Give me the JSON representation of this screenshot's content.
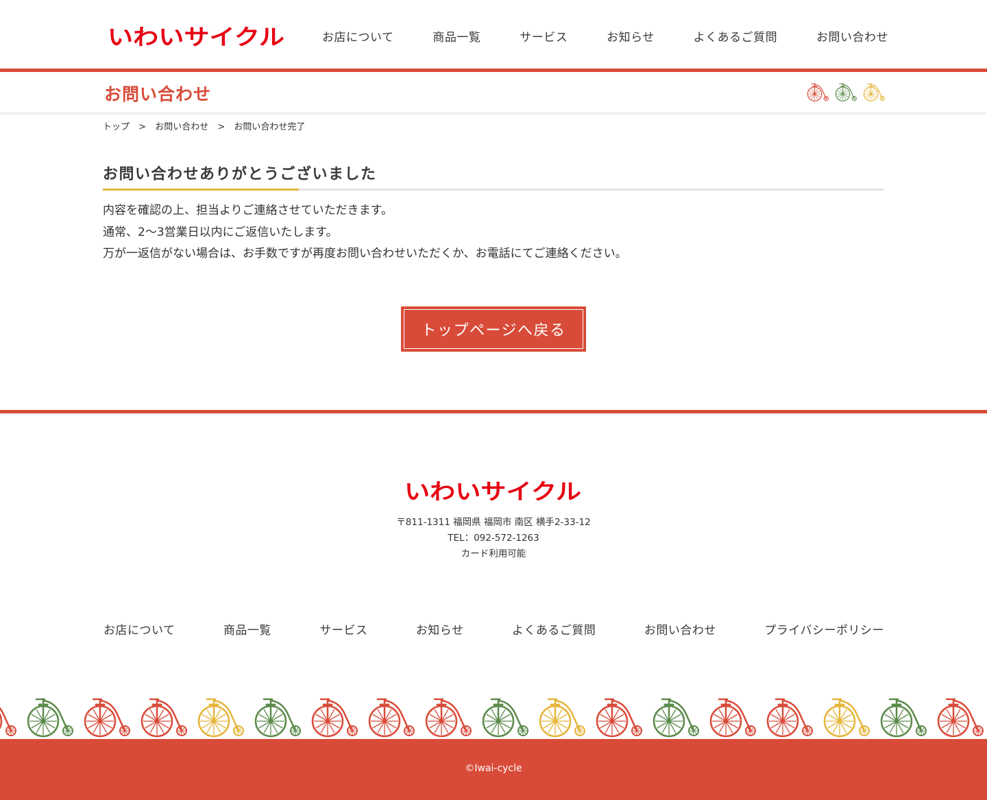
{
  "header": {
    "logo_text": "いわいサイクル",
    "nav": [
      "お店について",
      "商品一覧",
      "サービス",
      "お知らせ",
      "よくあるご質問",
      "お問い合わせ"
    ]
  },
  "page_title": "お問い合わせ",
  "breadcrumb": {
    "items": [
      "トップ",
      "お問い合わせ",
      "お問い合わせ完了"
    ],
    "separator": ">"
  },
  "main": {
    "heading": "お問い合わせありがとうございました",
    "lines": [
      "内容を確認の上、担当よりご連絡させていただきます。",
      "通常、2〜3営業日以内にご返信いたします。",
      "万が一返信がない場合は、お手数ですが再度お問い合わせいただくか、お電話にてご連絡ください。"
    ],
    "back_button": "トップページへ戻る"
  },
  "footer": {
    "logo_text": "いわいサイクル",
    "address": "〒811-1311 福岡県 福岡市 南区 横手2-33-12",
    "tel": "TEL：092-572-1263",
    "card": "カード利用可能",
    "nav": [
      "お店について",
      "商品一覧",
      "サービス",
      "お知らせ",
      "よくあるご質問",
      "お問い合わせ",
      "プライバシーポリシー"
    ],
    "copyright": "©Iwai-cycle"
  },
  "colors": {
    "brand_red": "#d94b39",
    "logo_red": "#e60012",
    "accent_yellow": "#e5b53a",
    "bike_green": "#5b8a4a"
  },
  "decor": {
    "title_bike_colors": [
      "#d94b39",
      "#5b8a4a",
      "#e5b53a"
    ],
    "footer_bike_colors": [
      "#d94b39",
      "#5b8a4a",
      "#d94b39",
      "#d94b39",
      "#e5b53a",
      "#5b8a4a",
      "#d94b39",
      "#d94b39",
      "#d94b39",
      "#5b8a4a",
      "#e5b53a",
      "#d94b39",
      "#5b8a4a",
      "#d94b39",
      "#d94b39",
      "#e5b53a",
      "#5b8a4a",
      "#d94b39"
    ],
    "icon": "penny-farthing-bicycle-icon"
  }
}
